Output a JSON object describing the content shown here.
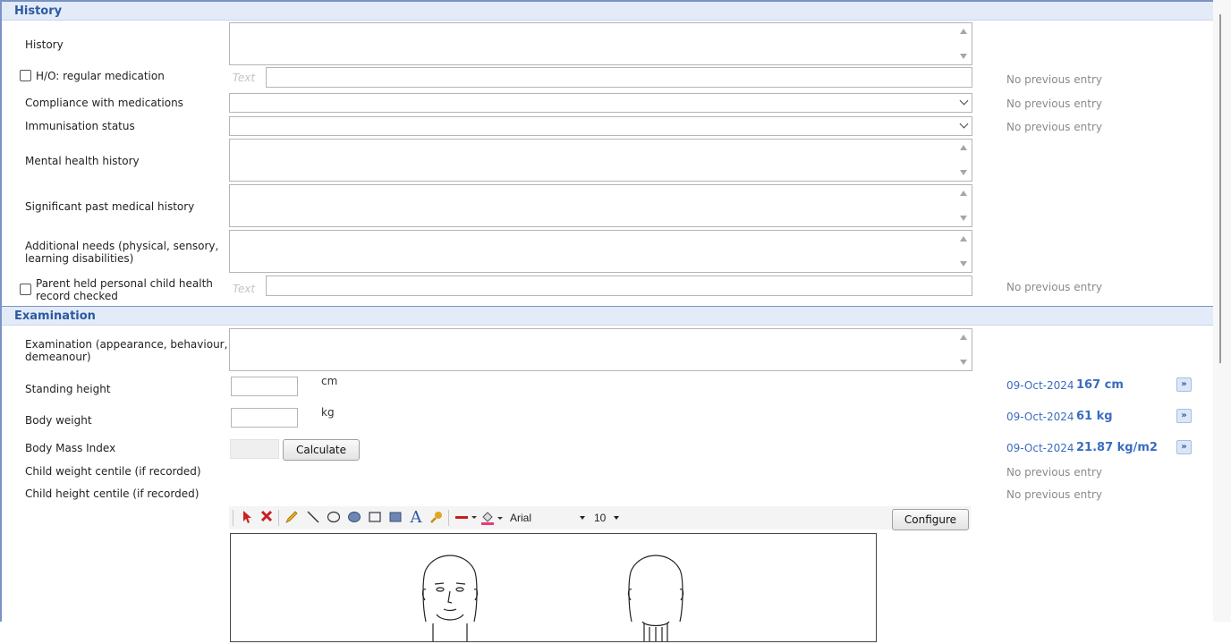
{
  "history": {
    "header": "History",
    "fields": {
      "history": "History",
      "regular_medication": "H/O: regular medication",
      "compliance": "Compliance with medications",
      "immunisation": "Immunisation status",
      "mental_health": "Mental health history",
      "past_medical": "Significant past medical history",
      "additional_needs_1": "Additional needs (physical, sensory,",
      "additional_needs_2": "learning disabilities)",
      "phr_1": "Parent held personal child health",
      "phr_2": "record checked"
    },
    "text_placeholder": "Text",
    "previous": {
      "regular_medication": "No previous entry",
      "compliance": "No previous entry",
      "immunisation": "No previous entry",
      "phr": "No previous entry"
    }
  },
  "examination": {
    "header": "Examination",
    "fields": {
      "exam_1": "Examination (appearance, behaviour,",
      "exam_2": "demeanour)",
      "height": "Standing height",
      "weight": "Body weight",
      "bmi": "Body Mass Index",
      "weight_centile": "Child weight centile (if recorded)",
      "height_centile": "Child height centile (if recorded)"
    },
    "units": {
      "height": "cm",
      "weight": "kg"
    },
    "calculate_label": "Calculate",
    "previous": {
      "height_date": "09-Oct-2024",
      "height_value": "167 cm",
      "weight_date": "09-Oct-2024",
      "weight_value": "61 kg",
      "bmi_date": "09-Oct-2024",
      "bmi_value": "21.87 kg/m2",
      "weight_centile": "No previous entry",
      "height_centile": "No previous entry"
    },
    "drawing": {
      "font": "Arial",
      "font_size": "10",
      "configure_label": "Configure",
      "tools": [
        "select-arrow-icon",
        "delete-icon",
        "pencil-icon",
        "line-icon",
        "ellipse-icon",
        "filled-ellipse-icon",
        "rectangle-icon",
        "filled-rectangle-icon",
        "text-icon",
        "highlighter-icon",
        "line-color-icon",
        "fill-color-icon"
      ]
    }
  },
  "colors": {
    "accent": "#2c5aa0",
    "value_blue": "#3a6cc2",
    "section_bg": "#e3ebf8",
    "muted": "#8a8a8a"
  }
}
